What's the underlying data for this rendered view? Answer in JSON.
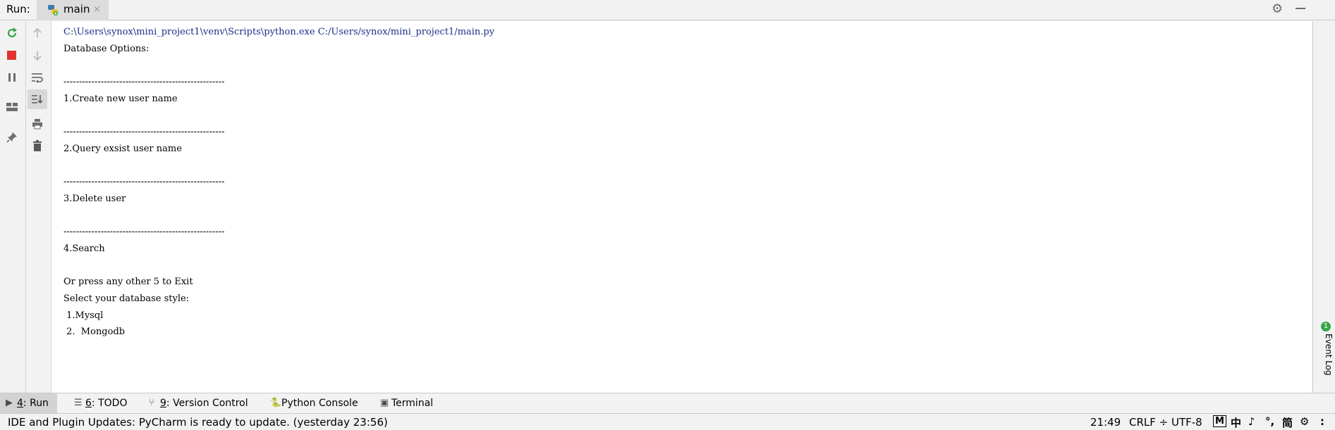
{
  "header": {
    "run_label": "Run:",
    "tab_title": "main",
    "tab_close": "×"
  },
  "console": {
    "lines": [
      "C:\\Users\\synox\\mini_project1\\venv\\Scripts\\python.exe C:/Users/synox/mini_project1/main.py",
      "Database Options:",
      "",
      "----------------------------------------------------",
      "1.Create new user name",
      "",
      "----------------------------------------------------",
      "2.Query exsist user name",
      "",
      "----------------------------------------------------",
      "3.Delete user",
      "",
      "----------------------------------------------------",
      "4.Search",
      "",
      "Or press any other 5 to Exit",
      "Select your database style:",
      " 1.Mysql",
      " 2.  Mongodb"
    ]
  },
  "right_strip": {
    "badge": "1",
    "event_log": "Event Log"
  },
  "tool_tabs": [
    {
      "key": "4",
      "label": ": Run"
    },
    {
      "key": "6",
      "label": ": TODO"
    },
    {
      "key": "9",
      "label": ": Version Control"
    },
    {
      "key": "",
      "label": "Python Console"
    },
    {
      "key": "",
      "label": "Terminal"
    }
  ],
  "status": {
    "message": "IDE and Plugin Updates: PyCharm is ready to update. (yesterday 23:56)",
    "position": "21:49",
    "line_sep": "CRLF ÷",
    "encoding": "UTF-8",
    "ime": [
      "M",
      "中",
      "♪",
      "°,",
      "简",
      "⚙",
      ":"
    ]
  },
  "colors": {
    "accent_green": "#3aa64b",
    "stop_red": "#e0332e",
    "command_blue": "#1a2f8a"
  }
}
